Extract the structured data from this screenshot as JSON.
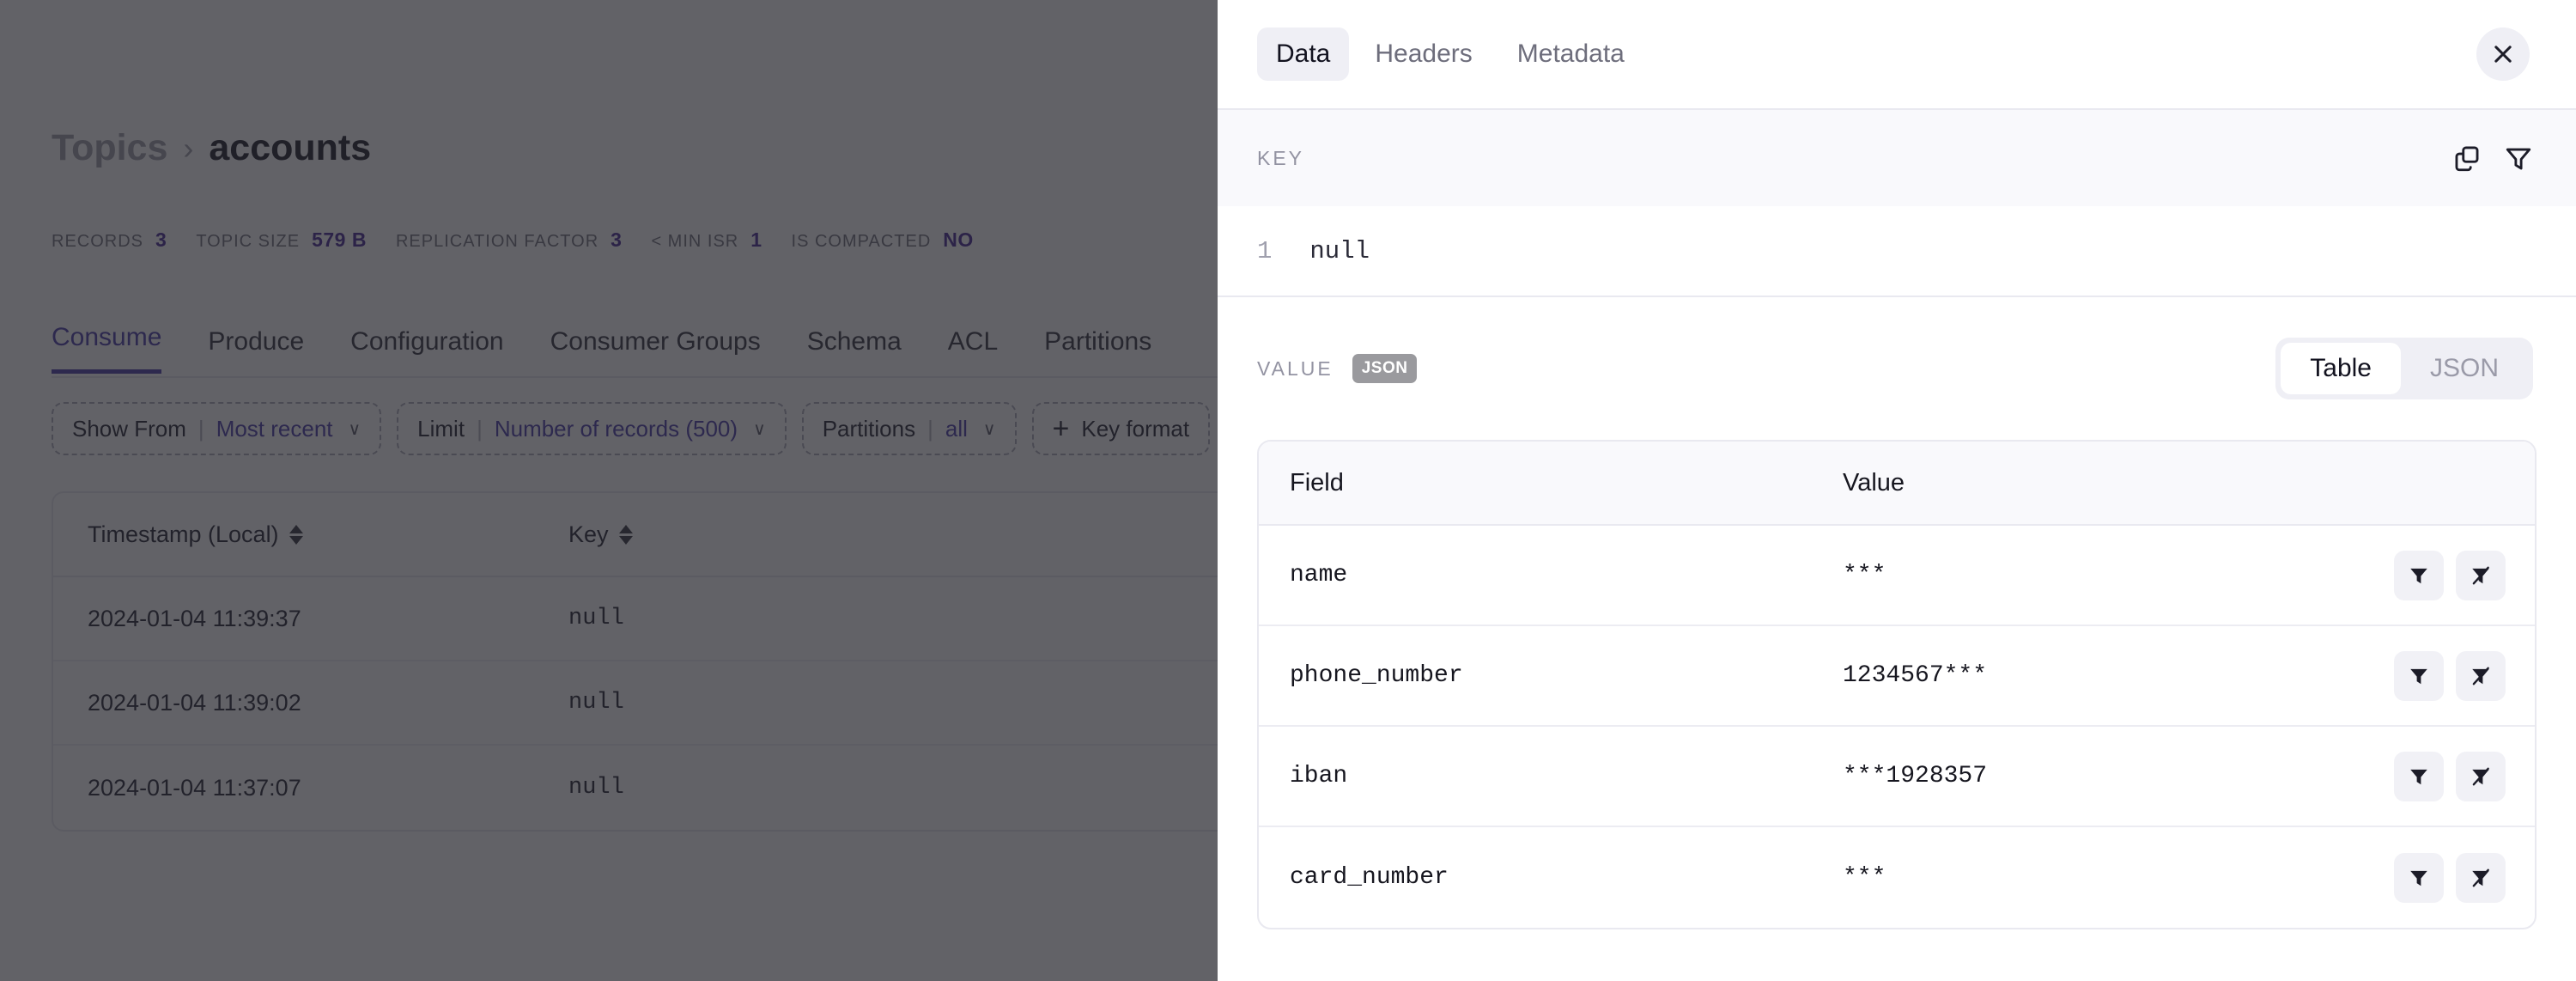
{
  "breadcrumb": {
    "parent": "Topics",
    "separator": "›",
    "current": "accounts"
  },
  "stats": [
    {
      "label": "Records",
      "value": "3"
    },
    {
      "label": "Topic size",
      "value": "579 B"
    },
    {
      "label": "Replication factor",
      "value": "3"
    },
    {
      "label": "< min ISR",
      "value": "1"
    },
    {
      "label": "Is compacted",
      "value": "NO"
    }
  ],
  "tabs": [
    {
      "label": "Consume",
      "active": true
    },
    {
      "label": "Produce",
      "active": false
    },
    {
      "label": "Configuration",
      "active": false
    },
    {
      "label": "Consumer Groups",
      "active": false
    },
    {
      "label": "Schema",
      "active": false
    },
    {
      "label": "ACL",
      "active": false
    },
    {
      "label": "Partitions",
      "active": false
    }
  ],
  "controls": [
    {
      "label": "Show From",
      "value": "Most recent",
      "chevron": "∨"
    },
    {
      "label": "Limit",
      "value": "Number of records (500)",
      "chevron": "∨"
    },
    {
      "label": "Partitions",
      "value": "all",
      "chevron": "∨"
    },
    {
      "label": "Key format",
      "plus": "+"
    }
  ],
  "records_table": {
    "columns": [
      "Timestamp (Local)",
      "Key"
    ],
    "rows": [
      {
        "timestamp": "2024-01-04 11:39:37",
        "key": "null"
      },
      {
        "timestamp": "2024-01-04 11:39:02",
        "key": "null"
      },
      {
        "timestamp": "2024-01-04 11:37:07",
        "key": "null"
      }
    ]
  },
  "panel": {
    "tabs": [
      {
        "label": "Data",
        "active": true
      },
      {
        "label": "Headers",
        "active": false
      },
      {
        "label": "Metadata",
        "active": false
      }
    ],
    "close_label": "×",
    "key_section": {
      "label": "KEY",
      "line_number": "1",
      "content": "null"
    },
    "value_section": {
      "label": "VALUE",
      "format_badge": "JSON",
      "view_modes": [
        {
          "label": "Table",
          "active": true
        },
        {
          "label": "JSON",
          "active": false
        }
      ],
      "columns": [
        "Field",
        "Value"
      ],
      "rows": [
        {
          "field": "name",
          "value": "***"
        },
        {
          "field": "phone_number",
          "value": "1234567***"
        },
        {
          "field": "iban",
          "value": "***1928357"
        },
        {
          "field": "card_number",
          "value": "***"
        }
      ]
    }
  },
  "colors": {
    "accent": "#4332a6",
    "stat_value": "#3d1f8f",
    "overlay": "rgba(38,38,45,0.72)",
    "badge_gray": "#9a9a9e"
  }
}
